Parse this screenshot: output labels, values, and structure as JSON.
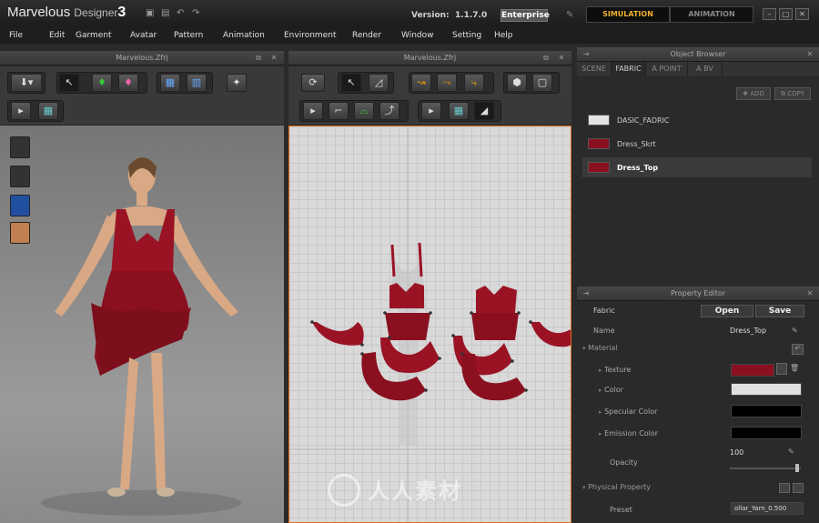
{
  "app": {
    "brand": "Marvelous",
    "brand_sub": "Designer",
    "brand_num": "3",
    "version_label": "Version:",
    "version_value": "1.1.7.0",
    "edition": "Enterprise",
    "mode_tabs": [
      "SIMULATION",
      "ANIMATION"
    ]
  },
  "menu": [
    "File",
    "Edit",
    "Garment",
    "Avatar",
    "Pattern",
    "Animation",
    "Environment",
    "Render",
    "Window",
    "Setting",
    "Help"
  ],
  "view3d": {
    "title": "Marvelous.Zfrj"
  },
  "view2d": {
    "title": "Marvelous.Zfrj"
  },
  "object_browser": {
    "title": "Object Browser",
    "tabs": [
      "SCENE",
      "FABRIC",
      "A POINT",
      "A BV"
    ],
    "active_tab": "FABRIC",
    "add_label": "ADD",
    "copy_label": "COPY",
    "fabrics": [
      {
        "name": "DASIC_FADRIC",
        "color": "#e4e4e4"
      },
      {
        "name": "Dress_Skrt",
        "color": "#8a1020"
      },
      {
        "name": "Dress_Top",
        "color": "#8a1020"
      }
    ]
  },
  "property_editor": {
    "title": "Property Editor",
    "fabric_label": "Fabric",
    "open_label": "Open",
    "save_label": "Save",
    "name_label": "Name",
    "name_value": "Dress_Top",
    "material_label": "Material",
    "texture_label": "Texture",
    "color_label": "Color",
    "specular_label": "Specular Color",
    "emission_label": "Emission Color",
    "opacity_label": "Opacity",
    "opacity_value": "100",
    "physical_label": "Physical Property",
    "preset_label": "Preset",
    "preset_value": "ollar_Yarn_0.500",
    "colors": {
      "texture": "#8a1020",
      "color": "#e0e0e0",
      "specular": "#000000",
      "emission": "#000000"
    }
  },
  "watermark": "人人素材"
}
